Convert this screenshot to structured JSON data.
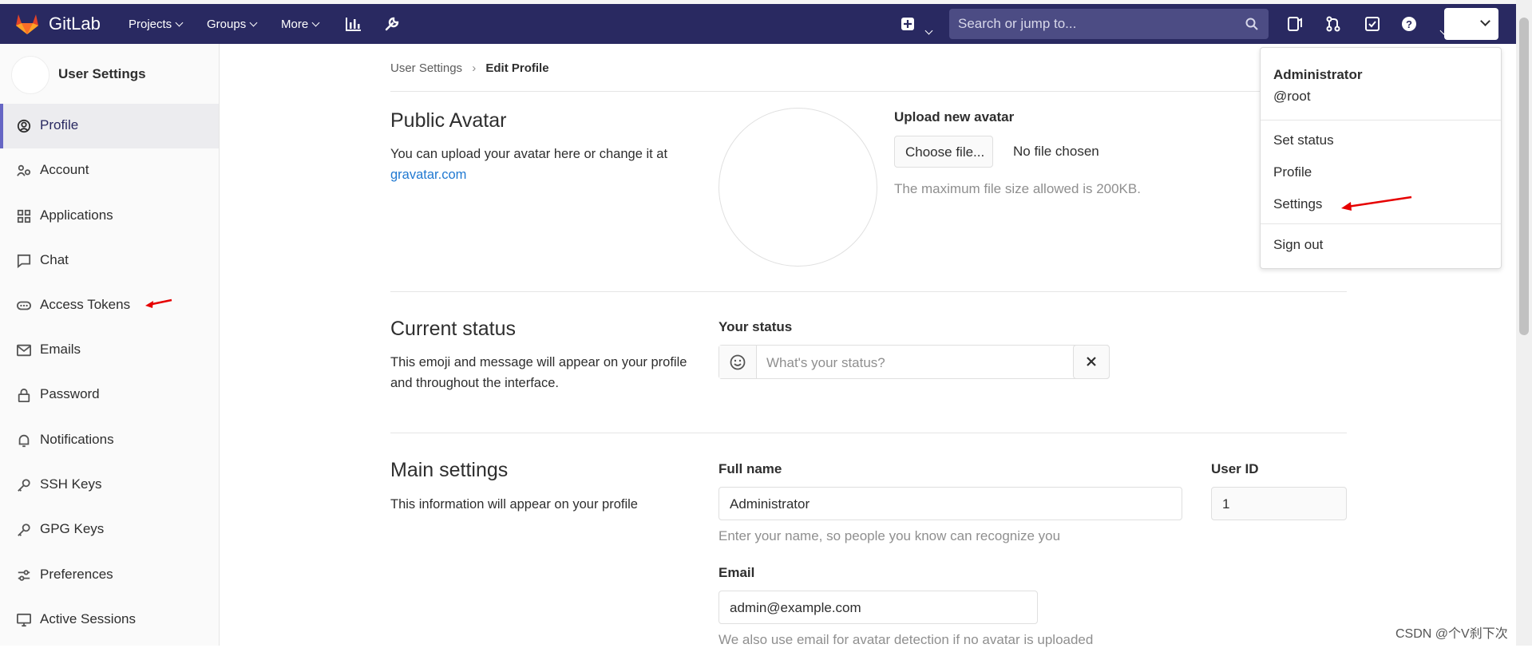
{
  "topbar": {
    "brand": "GitLab",
    "menu": [
      "Projects",
      "Groups",
      "More"
    ],
    "search_placeholder": "Search or jump to..."
  },
  "sidebar": {
    "title": "User Settings",
    "items": [
      {
        "label": "Profile",
        "icon": "profile-icon"
      },
      {
        "label": "Account",
        "icon": "account-icon"
      },
      {
        "label": "Applications",
        "icon": "applications-icon"
      },
      {
        "label": "Chat",
        "icon": "chat-icon"
      },
      {
        "label": "Access Tokens",
        "icon": "token-icon"
      },
      {
        "label": "Emails",
        "icon": "mail-icon"
      },
      {
        "label": "Password",
        "icon": "lock-icon"
      },
      {
        "label": "Notifications",
        "icon": "bell-icon"
      },
      {
        "label": "SSH Keys",
        "icon": "key-icon"
      },
      {
        "label": "GPG Keys",
        "icon": "key-icon"
      },
      {
        "label": "Preferences",
        "icon": "preferences-icon"
      },
      {
        "label": "Active Sessions",
        "icon": "monitor-icon"
      }
    ]
  },
  "breadcrumb": {
    "parent": "User Settings",
    "current": "Edit Profile"
  },
  "avatar_section": {
    "title": "Public Avatar",
    "desc": "You can upload your avatar here or change it at",
    "link": "gravatar.com",
    "upload_label": "Upload new avatar",
    "choose_button": "Choose file...",
    "file_status": "No file chosen",
    "help": "The maximum file size allowed is 200KB."
  },
  "status_section": {
    "title": "Current status",
    "desc": "This emoji and message will appear on your profile and throughout the interface.",
    "label": "Your status",
    "placeholder": "What's your status?"
  },
  "main_section": {
    "title": "Main settings",
    "desc": "This information will appear on your profile",
    "fullname_label": "Full name",
    "fullname_value": "Administrator",
    "fullname_help": "Enter your name, so people you know can recognize you",
    "userid_label": "User ID",
    "userid_value": "1",
    "email_label": "Email",
    "email_value": "admin@example.com",
    "email_help": "We also use email for avatar detection if no avatar is uploaded"
  },
  "user_dropdown": {
    "name": "Administrator",
    "username": "@root",
    "items": [
      "Set status",
      "Profile",
      "Settings"
    ],
    "signout": "Sign out"
  },
  "watermark": "CSDN @个V刹下次",
  "colors": {
    "topbar": "#292961",
    "accent": "#6666c4",
    "link": "#1f78d1",
    "annotation": "#e60000"
  }
}
